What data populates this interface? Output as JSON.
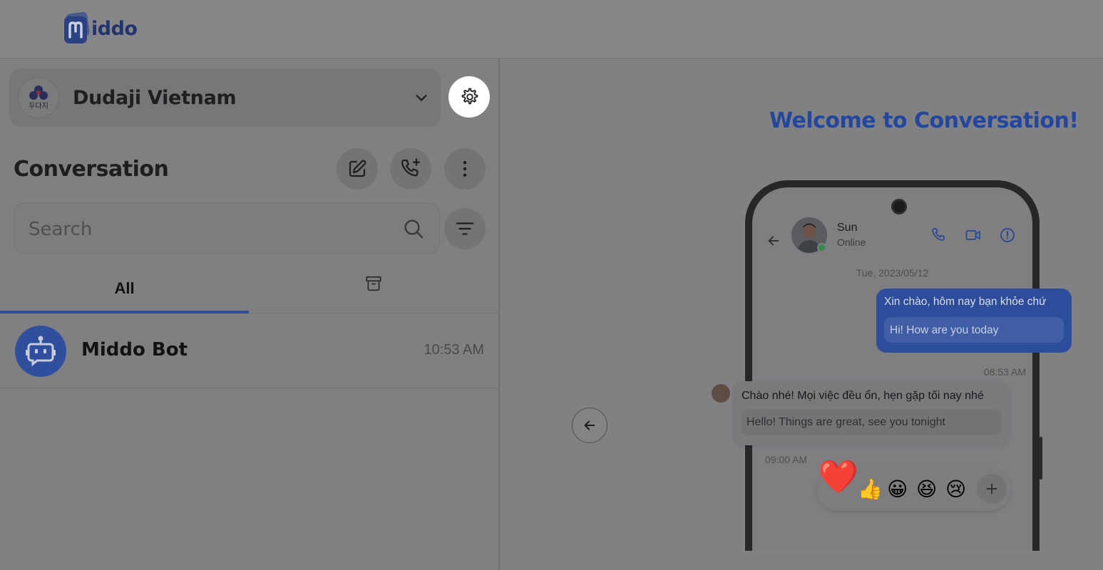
{
  "app": {
    "logo_text": "iddo",
    "logo_icon": "middo-m-logo"
  },
  "workspace": {
    "name": "Dudaji Vietnam",
    "avatar_icon": "dudaji-logo",
    "avatar_caption": "두다지"
  },
  "sidebar": {
    "title": "Conversation",
    "actions": [
      "new-message-icon",
      "add-call-icon",
      "more-vertical-icon"
    ],
    "search": {
      "placeholder": "Search"
    },
    "tabs": [
      {
        "label": "All",
        "active": true
      },
      {
        "icon": "archive-icon",
        "active": false
      }
    ],
    "conversations": [
      {
        "name": "Middo Bot",
        "time": "10:53 AM"
      }
    ]
  },
  "main": {
    "welcome": "Welcome to Conversation!",
    "preview": {
      "contact": {
        "name": "Sun",
        "status": "Online"
      },
      "date": "Tue, 2023/05/12",
      "outgoing": {
        "text": "Xin chào, hôm nay bạn khỏe chứ",
        "translation": "Hi! How are you today",
        "time": "08:53 AM"
      },
      "incoming": {
        "text": "Chào nhé! Mọi việc đều ổn, hẹn gặp tối nay nhé",
        "translation": "Hello! Things are great, see you tonight",
        "time": "09:00 AM"
      },
      "reactions": [
        "❤️",
        "👍",
        "😀",
        "😆",
        "😢"
      ]
    }
  },
  "colors": {
    "brand": "#2f4f9c",
    "accent_text": "#23479c",
    "overlay": "#808083"
  }
}
